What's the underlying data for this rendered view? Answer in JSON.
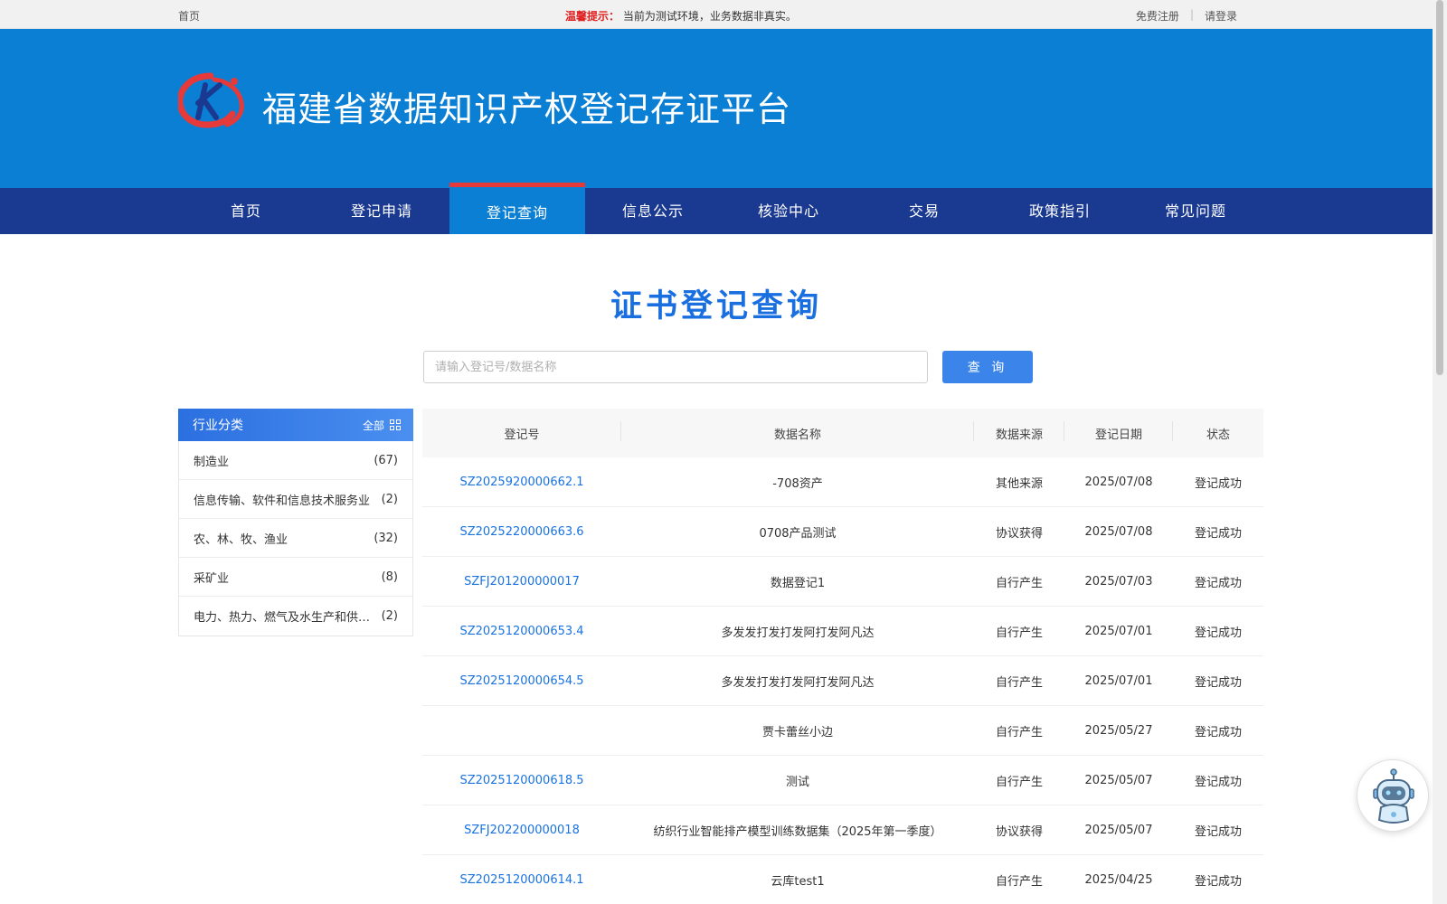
{
  "topbar": {
    "home": "首页",
    "notice_label": "温馨提示：",
    "notice_text": "当前为测试环境，业务数据非真实。",
    "register": "免费注册",
    "separator": "|",
    "login": "请登录"
  },
  "header": {
    "title": "福建省数据知识产权登记存证平台",
    "logo_letter": "K"
  },
  "nav": {
    "items": [
      "首页",
      "登记申请",
      "登记查询",
      "信息公示",
      "核验中心",
      "交易",
      "政策指引",
      "常见问题"
    ],
    "active": "登记查询"
  },
  "page": {
    "title": "证书登记查询"
  },
  "search": {
    "placeholder": "请输入登记号/数据名称",
    "value": "",
    "button": "查 询"
  },
  "sidebar": {
    "title": "行业分类",
    "all_label": "全部",
    "items": [
      {
        "name": "制造业",
        "count": "(67)"
      },
      {
        "name": "信息传输、软件和信息技术服务业",
        "count": "(2)"
      },
      {
        "name": "农、林、牧、渔业",
        "count": "(32)"
      },
      {
        "name": "采矿业",
        "count": "(8)"
      },
      {
        "name": "电力、热力、燃气及水生产和供应业",
        "count": "(2)"
      }
    ]
  },
  "table": {
    "headers": [
      "登记号",
      "数据名称",
      "数据来源",
      "登记日期",
      "状态"
    ],
    "rows": [
      {
        "reg_no": "SZ2025920000662.1",
        "name": "-708资产",
        "source": "其他来源",
        "date": "2025/07/08",
        "status": "登记成功"
      },
      {
        "reg_no": "SZ2025220000663.6",
        "name": "0708产品测试",
        "source": "协议获得",
        "date": "2025/07/08",
        "status": "登记成功"
      },
      {
        "reg_no": "SZFJ201200000017",
        "name": "数据登记1",
        "source": "自行产生",
        "date": "2025/07/03",
        "status": "登记成功"
      },
      {
        "reg_no": "SZ2025120000653.4",
        "name": "多发发打发打发阿打发阿凡达",
        "source": "自行产生",
        "date": "2025/07/01",
        "status": "登记成功"
      },
      {
        "reg_no": "SZ2025120000654.5",
        "name": "多发发打发打发阿打发阿凡达",
        "source": "自行产生",
        "date": "2025/07/01",
        "status": "登记成功"
      },
      {
        "reg_no": "",
        "name": "贾卡蕾丝小边",
        "source": "自行产生",
        "date": "2025/05/27",
        "status": "登记成功"
      },
      {
        "reg_no": "SZ2025120000618.5",
        "name": "测试",
        "source": "自行产生",
        "date": "2025/05/07",
        "status": "登记成功"
      },
      {
        "reg_no": "SZFJ202200000018",
        "name": "纺织行业智能排产模型训练数据集（2025年第一季度）",
        "source": "协议获得",
        "date": "2025/05/07",
        "status": "登记成功"
      },
      {
        "reg_no": "SZ2025120000614.1",
        "name": "云库test1",
        "source": "自行产生",
        "date": "2025/04/25",
        "status": "登记成功"
      }
    ]
  },
  "colors": {
    "header_blue": "#0b7fd4",
    "nav_navy": "#1a3990",
    "link_blue": "#1a73e0",
    "active_bar_red": "#e63a3a"
  }
}
